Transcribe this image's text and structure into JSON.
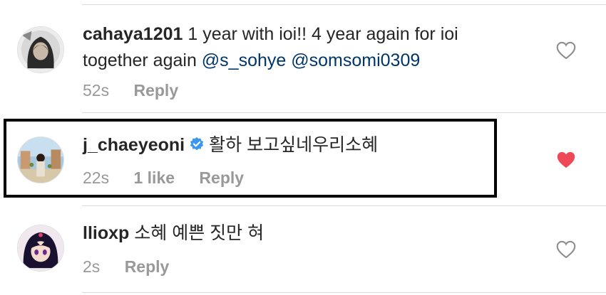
{
  "comments": [
    {
      "username": "cahaya1201",
      "text_part1": "1 year with ioi!! 4 year again for ioi together again ",
      "mentions": [
        "@s_sohye",
        "@somsomi0309"
      ],
      "time": "52s",
      "likes": "",
      "reply": "Reply",
      "liked": false
    },
    {
      "username": "j_chaeyeoni",
      "verified": true,
      "text": "활하 보고싶네우리소혜",
      "time": "22s",
      "likes": "1 like",
      "reply": "Reply",
      "liked": true
    },
    {
      "username": "llioxp",
      "text": "소혜 예쁜 짓만 혀",
      "time": "2s",
      "likes": "",
      "reply": "Reply",
      "liked": false
    }
  ],
  "icons": {
    "heart_outline": "heart-outline-icon",
    "heart_filled": "heart-filled-icon",
    "verified": "verified-badge-icon"
  },
  "colors": {
    "liked_heart": "#ed4956",
    "verified_badge": "#3897f0",
    "mention": "#003569",
    "meta_text": "#999999"
  }
}
